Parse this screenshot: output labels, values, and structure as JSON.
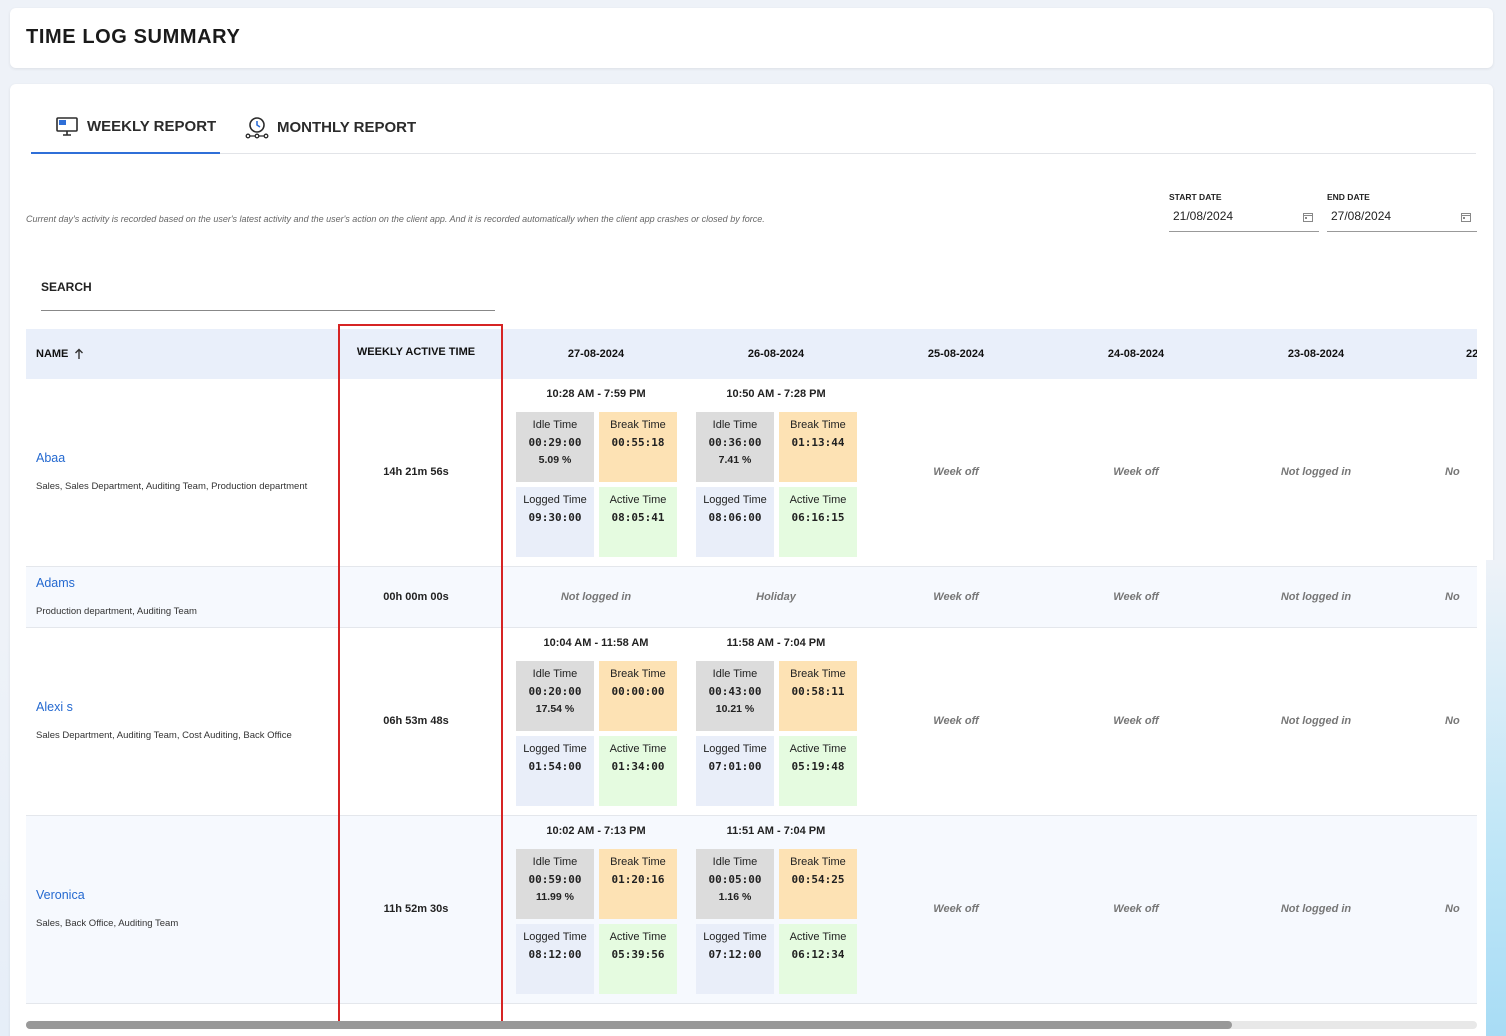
{
  "header": {
    "title": "TIME LOG SUMMARY"
  },
  "tabs": [
    {
      "label": "WEEKLY REPORT",
      "icon": "monitor-icon",
      "active": true
    },
    {
      "label": "MONTHLY REPORT",
      "icon": "clock-icon",
      "active": false
    }
  ],
  "notice": "Current day's activity is recorded based on the user's latest activity and the user's action on the client app. And it is recorded automatically when the client app crashes or closed by force.",
  "filters": {
    "start_date": {
      "label": "START DATE",
      "value": "21/08/2024"
    },
    "end_date": {
      "label": "END DATE",
      "value": "27/08/2024"
    }
  },
  "search": {
    "label": "SEARCH"
  },
  "table": {
    "columns": {
      "name": "NAME",
      "weekly": "WEEKLY ACTIVE TIME",
      "dates": [
        "27-08-2024",
        "26-08-2024",
        "25-08-2024",
        "24-08-2024",
        "23-08-2024",
        "22"
      ]
    },
    "tile_labels": {
      "idle": "Idle Time",
      "break": "Break Time",
      "logged": "Logged Time",
      "active": "Active Time"
    },
    "rows": [
      {
        "name": "Abaa",
        "departments": "Sales, Sales Department, Auditing Team, Production department",
        "weekly_active": "14h 21m 56s",
        "days": [
          {
            "range": "10:28 AM - 7:59 PM",
            "idle": "00:29:00",
            "idle_pct": "5.09 %",
            "break": "00:55:18",
            "logged": "09:30:00",
            "active": "08:05:41"
          },
          {
            "range": "10:50 AM - 7:28 PM",
            "idle": "00:36:00",
            "idle_pct": "7.41 %",
            "break": "01:13:44",
            "logged": "08:06:00",
            "active": "06:16:15"
          },
          {
            "status": "Week off"
          },
          {
            "status": "Week off"
          },
          {
            "status": "Not logged in"
          },
          {
            "status": "No"
          }
        ]
      },
      {
        "name": "Adams",
        "departments": "Production department, Auditing Team",
        "weekly_active": "00h 00m 00s",
        "days": [
          {
            "status": "Not logged in"
          },
          {
            "status": "Holiday"
          },
          {
            "status": "Week off"
          },
          {
            "status": "Week off"
          },
          {
            "status": "Not logged in"
          },
          {
            "status": "No"
          }
        ]
      },
      {
        "name": "Alexi s",
        "departments": "Sales Department, Auditing Team, Cost Auditing, Back Office",
        "weekly_active": "06h 53m 48s",
        "days": [
          {
            "range": "10:04 AM - 11:58 AM",
            "idle": "00:20:00",
            "idle_pct": "17.54 %",
            "break": "00:00:00",
            "logged": "01:54:00",
            "active": "01:34:00"
          },
          {
            "range": "11:58 AM - 7:04 PM",
            "idle": "00:43:00",
            "idle_pct": "10.21 %",
            "break": "00:58:11",
            "logged": "07:01:00",
            "active": "05:19:48"
          },
          {
            "status": "Week off"
          },
          {
            "status": "Week off"
          },
          {
            "status": "Not logged in"
          },
          {
            "status": "No"
          }
        ]
      },
      {
        "name": "Veronica",
        "departments": "Sales, Back Office, Auditing Team",
        "weekly_active": "11h 52m 30s",
        "days": [
          {
            "range": "10:02 AM - 7:13 PM",
            "idle": "00:59:00",
            "idle_pct": "11.99 %",
            "break": "01:20:16",
            "logged": "08:12:00",
            "active": "05:39:56"
          },
          {
            "range": "11:51 AM - 7:04 PM",
            "idle": "00:05:00",
            "idle_pct": "1.16 %",
            "break": "00:54:25",
            "logged": "07:12:00",
            "active": "06:12:34"
          },
          {
            "status": "Week off"
          },
          {
            "status": "Week off"
          },
          {
            "status": "Not logged in"
          },
          {
            "status": "No"
          }
        ]
      }
    ]
  },
  "colors": {
    "accent": "#2f6fd8",
    "highlight": "#d62424",
    "name_link": "#2469d0"
  }
}
